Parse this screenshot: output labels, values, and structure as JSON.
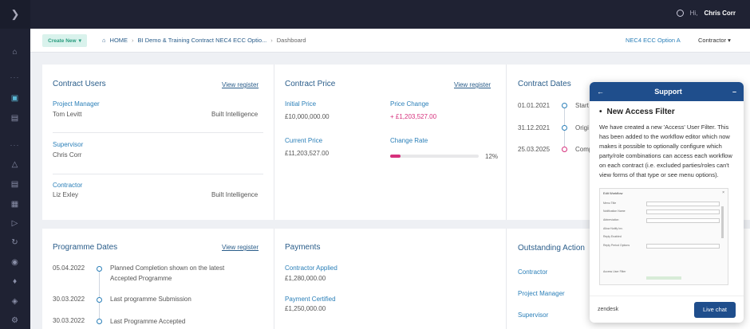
{
  "topbar": {
    "greeting": "Hi,",
    "user_name": "Chris Corr"
  },
  "crumbbar": {
    "create_label": "Create New",
    "crumbs": [
      "HOME",
      "BI Demo & Training Contract NEC4 ECC Optio...",
      "Dashboard"
    ],
    "contract_type": "NEC4 ECC Option A",
    "role": "Contractor"
  },
  "contract_users": {
    "title": "Contract Users",
    "link": "View register",
    "rows": [
      {
        "role": "Project Manager",
        "name": "Tom Levitt",
        "company": "Built Intelligence"
      },
      {
        "role": "Supervisor",
        "name": "Chris Corr",
        "company": ""
      },
      {
        "role": "Contractor",
        "name": "Liz Exley",
        "company": "Built Intelligence"
      }
    ]
  },
  "contract_price": {
    "title": "Contract Price",
    "link": "View register",
    "initial_label": "Initial Price",
    "initial_value": "£10,000,000.00",
    "change_label": "Price Change",
    "change_value": "+ £1,203,527.00",
    "current_label": "Current Price",
    "current_value": "£11,203,527.00",
    "rate_label": "Change Rate",
    "rate_value": "12%",
    "rate_fraction": 0.12
  },
  "contract_dates": {
    "title": "Contract Dates",
    "rows": [
      {
        "date": "01.01.2021",
        "label": "Start"
      },
      {
        "date": "31.12.2021",
        "label": "Origi"
      },
      {
        "date": "25.03.2025",
        "label": "Comp"
      }
    ]
  },
  "programme_dates": {
    "title": "Programme Dates",
    "link": "View register",
    "rows": [
      {
        "date": "05.04.2022",
        "label": "Planned Completion shown on the latest",
        "label2": "Accepted Programme"
      },
      {
        "date": "30.03.2022",
        "label": "Last programme Submission",
        "label2": ""
      },
      {
        "date": "30.03.2022",
        "label": "Last Programme Accepted",
        "label2": ""
      }
    ]
  },
  "payments": {
    "title": "Payments",
    "applied_label": "Contractor Applied",
    "applied_value": "£1,280,000.00",
    "certified_label": "Payment Certified",
    "certified_value": "£1,250,000.00"
  },
  "outstanding": {
    "title": "Outstanding Action",
    "rows": [
      "Contractor",
      "Project Manager",
      "Supervisor"
    ]
  },
  "support": {
    "title": "Support",
    "heading": "New Access Filter",
    "text": "We have created a new 'Access' User Filter. This has been added to the workflow editor which now makes it possible to optionally configure which party/role combinations can access each workflow on each contract (i.e. excluded parties/roles can't view forms of that type or see menu options).",
    "shot_title": "Edit Workflow",
    "shot_rows": [
      "Menu Title",
      "Notification Name",
      "Abbreviation",
      "Allow Notify Inv.",
      "Reply Enabled",
      "Reply Period Options",
      "",
      "Access User Filter"
    ],
    "footer_brand": "zendesk",
    "live_chat": "Live chat",
    "colors": {
      "header": "#1f4e8c"
    }
  }
}
